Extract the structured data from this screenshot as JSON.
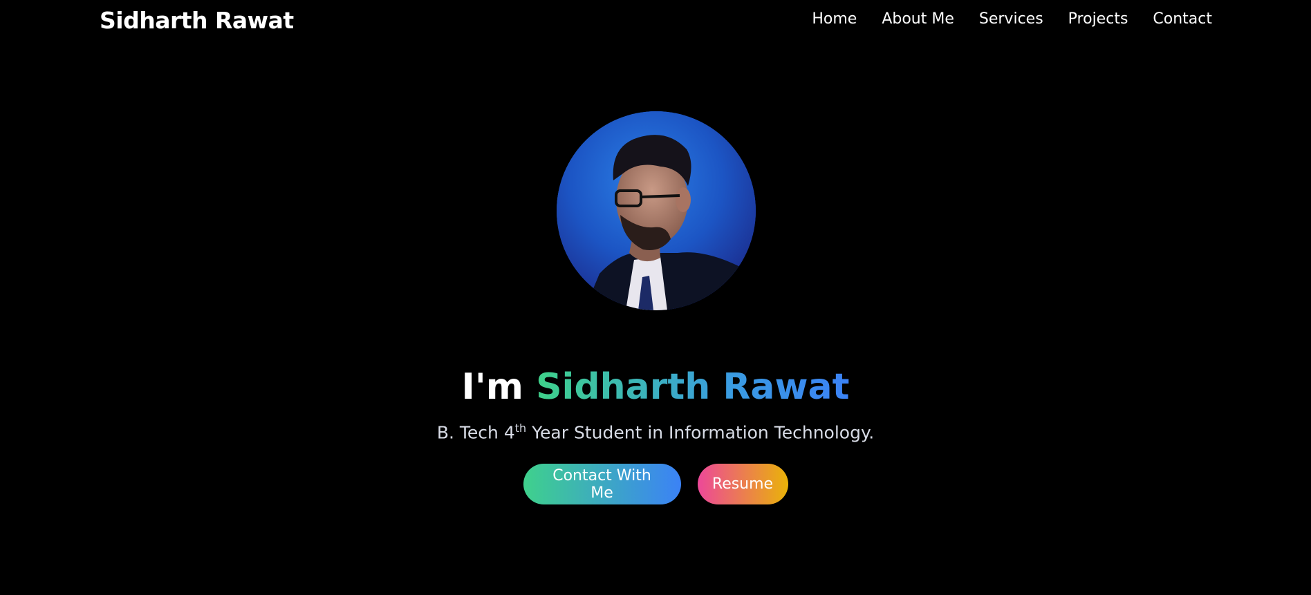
{
  "brand": "Sidharth Rawat",
  "nav": {
    "items": [
      {
        "label": "Home"
      },
      {
        "label": "About Me"
      },
      {
        "label": "Services"
      },
      {
        "label": "Projects"
      },
      {
        "label": "Contact"
      }
    ]
  },
  "hero": {
    "headline_prefix": "I'm",
    "headline_name": "Sidharth Rawat",
    "subtitle_pre": "B. Tech 4",
    "subtitle_sup": "th",
    "subtitle_post": " Year Student in Information Technology.",
    "buttons": {
      "contact_label": "Contact With Me",
      "resume_label": "Resume"
    }
  },
  "colors": {
    "background": "#000000",
    "name_gradient": [
      "#3fd28a",
      "#3b82f6"
    ],
    "contact_gradient": [
      "#3fd18c",
      "#3b82f6"
    ],
    "resume_gradient": [
      "#ec4899",
      "#eab308"
    ]
  }
}
